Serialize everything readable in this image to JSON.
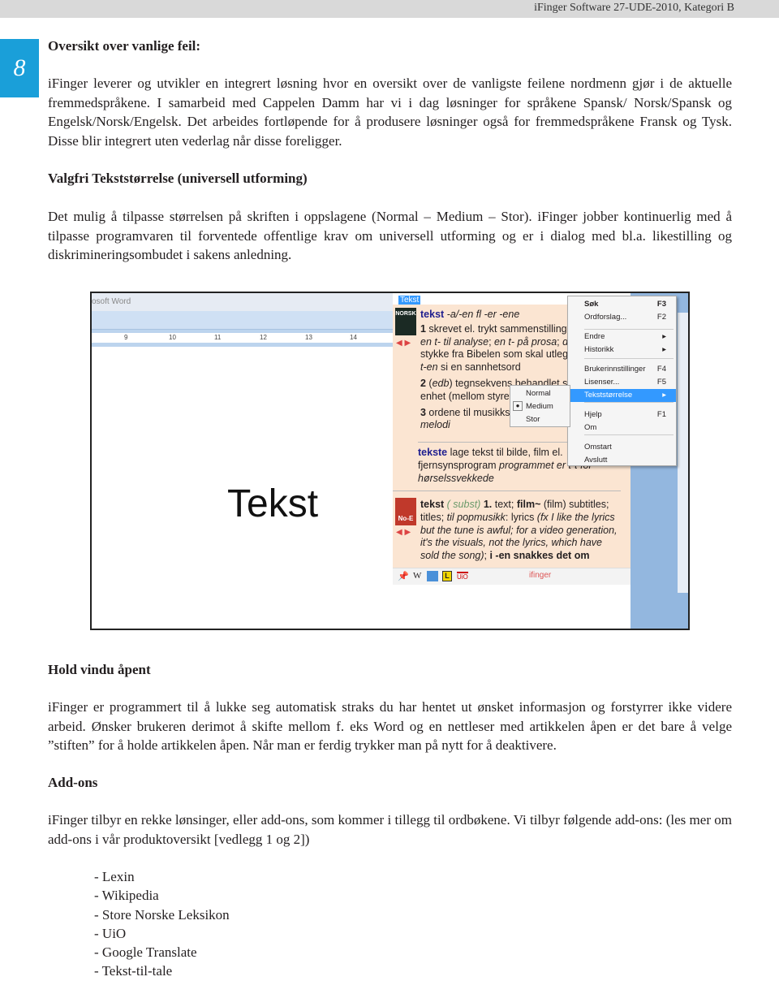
{
  "header": {
    "text": "iFinger Software 27-UDE-2010, Kategori B"
  },
  "page_number": "8",
  "sections": [
    {
      "heading": "Oversikt over vanlige feil:",
      "body": "iFinger leverer og utvikler en integrert løsning hvor en oversikt over de vanligste feilene nordmenn gjør i de aktuelle fremmedspråkene. I samarbeid med Cappelen Damm har vi i dag løsninger for språkene Spansk/ Norsk/Spansk og Engelsk/Norsk/Engelsk. Det arbeides fortløpende for å produsere løsninger også for fremmedspråkene Fransk og Tysk. Disse blir integrert uten vederlag når disse foreligger."
    },
    {
      "heading": "Valgfri Tekststørrelse (universell utforming)",
      "body": "Det mulig å tilpasse størrelsen på skriften i oppslagene (Normal – Medium – Stor). iFinger jobber kontinuerlig med å tilpasse programvaren til forventede offentlige krav om universell utforming og er i dialog med bl.a. likestilling og diskrimineringsombudet i sakens anledning."
    },
    {
      "heading": "Hold vindu åpent",
      "body": "iFinger er programmert til å lukke seg automatisk straks du har hentet ut ønsket informasjon og forstyrrer ikke videre arbeid. Ønsker brukeren derimot å skifte mellom f. eks Word og en nettleser med artikkelen åpen er det bare å velge ”stiften” for å holde artikkelen åpen. Når man er ferdig trykker man på nytt for å deaktivere."
    },
    {
      "heading": "Add-ons",
      "body": "iFinger tilbyr en rekke lønsinger, eller add-ons,  som kommer i tillegg til ordbøkene. Vi tilbyr følgende add-ons: (les mer om add-ons i vår produktoversikt [vedlegg 1 og 2])"
    }
  ],
  "addons": [
    "- Lexin",
    "- Wikipedia",
    "- Store Norske Leksikon",
    "- UiO",
    "- Google Translate",
    "- Tekst-til-tale"
  ],
  "screenshot": {
    "word_title": "osoft Word",
    "ruler": [
      "9",
      "10",
      "11",
      "12",
      "13",
      "14"
    ],
    "doc_text": "Tekst",
    "popup_title": "Tekst",
    "norsk": {
      "book": "NORSK",
      "headword": "tekst",
      "inflection": "-a/-en fl -er -ene",
      "senses": [
        {
          "n": "1",
          "html": "skrevet el. trykt sammenstilling av ord; <i>få en t- til analyse</i>; <i>en t- på prosa</i>; <i>dagens t-</i> stykke fra Bibelen som skal utlegges; <i>lese en t-en</i> si en sannhetsord"
        },
        {
          "n": "2",
          "html": "(<i>edb</i>) tegnsekvens behandlet som en enhet (mellom styretegn)"
        },
        {
          "n": "3",
          "html": "ordene til musikkstykke; <i>laget både t- og melodi</i>"
        }
      ],
      "headword2": "tekste",
      "def2": "lage tekst til bilde, film el. fjernsynsprogram <i>programmet er t-t for hørselssvekkede</i>"
    },
    "noe": {
      "book": "No-E",
      "html": "<b>tekst</b> <i style='color:#6a9a6a'>( subst)</i> <b>1.</b> text; <b>film~</b> (film) subtitles; titles; <i>til popmusikk</i>: lyrics <i>(fx I like the lyrics but the tune is awful; for a video generation, it's the visuals, not the lyrics, which have sold the song)</i>; <b>i -en snakkes det om</b>"
    },
    "menu": [
      {
        "label": "Søk",
        "key": "F3",
        "bold": true
      },
      {
        "label": "Ordforslag...",
        "key": "F2"
      },
      {
        "label": "Endre",
        "key": "▸"
      },
      {
        "label": "Historikk",
        "key": "▸"
      },
      {
        "label": "Brukerinnstillinger",
        "key": "F4"
      },
      {
        "label": "Lisenser...",
        "key": "F5"
      },
      {
        "label": "Tekststørrelse",
        "key": "▸",
        "selected": true
      },
      {
        "label": "Hjelp",
        "key": "F1"
      },
      {
        "label": "Om",
        "key": ""
      },
      {
        "label": "Omstart",
        "key": ""
      },
      {
        "label": "Avslutt",
        "key": ""
      }
    ],
    "submenu": [
      "Normal",
      "Medium",
      "Stor"
    ],
    "submenu_selected": "Medium",
    "toolbar": {
      "brand": "ifinger",
      "icons": [
        "pin-icon",
        "wikipedia-icon",
        "translate-icon",
        "lexin-icon",
        "uio-icon"
      ]
    }
  },
  "colors": {
    "badge": "#1a9fd9",
    "popup_bg": "#fbe5d2",
    "menu_highlight": "#3399ff",
    "headword": "#1f1f8f"
  }
}
